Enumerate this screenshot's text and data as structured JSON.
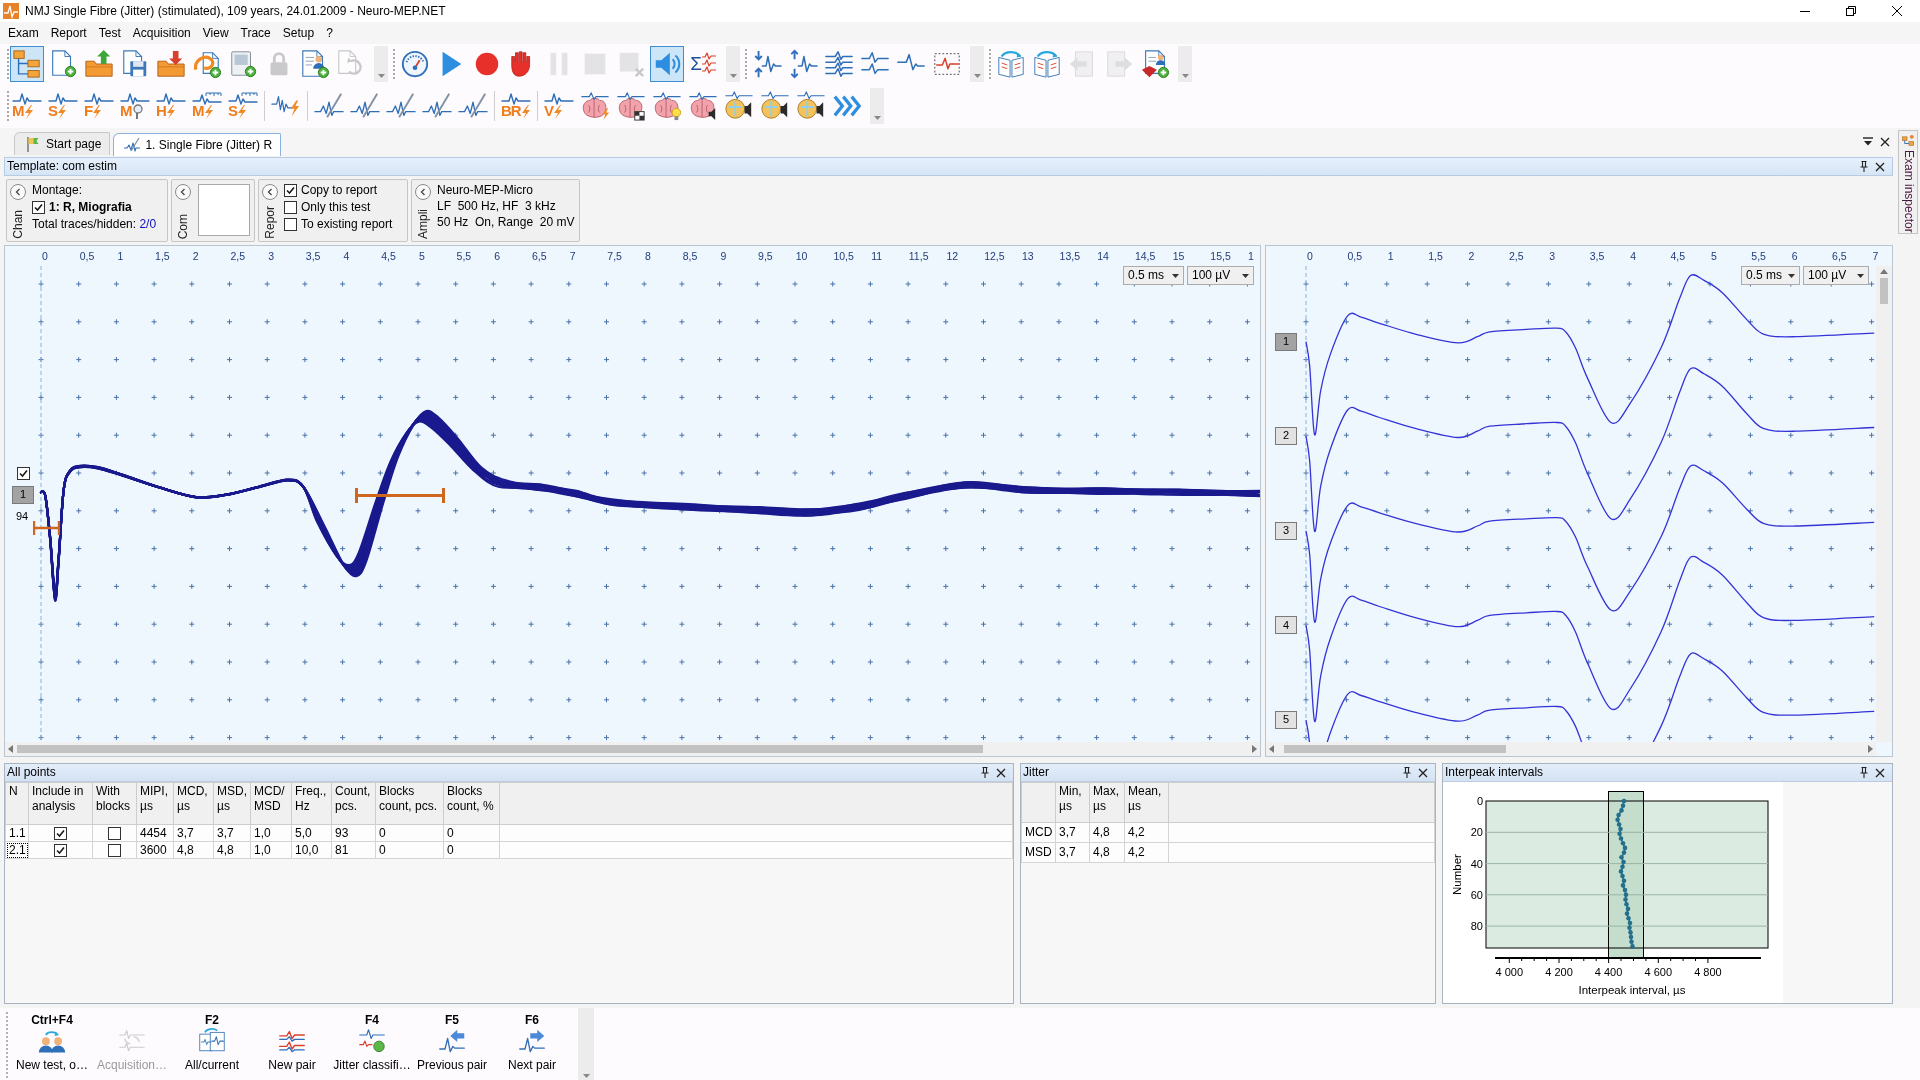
{
  "window": {
    "title": "NMJ Single Fibre (Jitter) (stimulated), 109 years, 24.01.2009 - Neuro-MEP.NET"
  },
  "menu": [
    "Exam",
    "Report",
    "Test",
    "Acquisition",
    "View",
    "Trace",
    "Setup",
    "?"
  ],
  "toolbars": [
    {
      "bands": [
        {
          "groups": [
            [
              {
                "kind": "tree",
                "pressed": true,
                "disabled": false
              },
              {
                "kind": "doc-add",
                "pressed": false,
                "disabled": false
              },
              {
                "kind": "folder-up",
                "pressed": false,
                "disabled": false
              },
              {
                "kind": "save",
                "pressed": false,
                "disabled": false
              },
              {
                "kind": "folder-down",
                "pressed": false,
                "disabled": false
              },
              {
                "kind": "swirl-doc",
                "pressed": false,
                "disabled": false
              },
              {
                "kind": "device-add",
                "pressed": false,
                "disabled": false
              },
              {
                "kind": "lock",
                "pressed": false,
                "disabled": true
              },
              {
                "kind": "report-person",
                "pressed": false,
                "disabled": false
              },
              {
                "kind": "doc-refresh",
                "pressed": false,
                "disabled": true
              }
            ]
          ]
        },
        {
          "groups": [
            [
              {
                "kind": "gauge",
                "pressed": false,
                "disabled": false
              },
              {
                "kind": "play",
                "pressed": false,
                "disabled": false
              },
              {
                "kind": "record",
                "pressed": false,
                "disabled": false
              },
              {
                "kind": "hand",
                "pressed": false,
                "disabled": false
              },
              {
                "kind": "pause",
                "pressed": false,
                "disabled": true
              },
              {
                "kind": "stop",
                "pressed": false,
                "disabled": true
              },
              {
                "kind": "stop-x",
                "pressed": false,
                "disabled": true
              },
              {
                "kind": "speaker",
                "pressed": true,
                "disabled": false
              },
              {
                "kind": "sigma",
                "label": "Σ",
                "pressed": false,
                "disabled": false
              }
            ]
          ]
        },
        {
          "groups": [
            [
              {
                "kind": "arrows-in",
                "pressed": false,
                "disabled": false
              },
              {
                "kind": "arrows-out",
                "pressed": false,
                "disabled": false
              },
              {
                "kind": "wave-stack",
                "pressed": false,
                "disabled": false
              },
              {
                "kind": "wave-split",
                "pressed": false,
                "disabled": false
              },
              {
                "kind": "wave",
                "pressed": false,
                "disabled": false
              },
              {
                "kind": "dashed-box",
                "pressed": false,
                "disabled": false
              }
            ]
          ]
        },
        {
          "groups": [
            [
              {
                "kind": "book-refresh",
                "pressed": false,
                "disabled": false
              },
              {
                "kind": "book-refresh",
                "pressed": false,
                "disabled": false
              },
              {
                "kind": "page-left",
                "pressed": false,
                "disabled": true
              },
              {
                "kind": "page-right",
                "pressed": false,
                "disabled": true
              },
              {
                "kind": "report-add",
                "pressed": false,
                "disabled": false
              }
            ]
          ]
        }
      ]
    },
    {
      "bands": [
        {
          "groups": [
            [
              {
                "kind": "stim",
                "label": "M"
              },
              {
                "kind": "stim",
                "label": "S"
              },
              {
                "kind": "stim",
                "label": "F"
              },
              {
                "kind": "probe",
                "label": "M"
              },
              {
                "kind": "stim",
                "label": "H"
              },
              {
                "kind": "stim-ruler",
                "label": "M"
              },
              {
                "kind": "stim-ruler",
                "label": "S"
              }
            ],
            [
              {
                "kind": "wave-flash"
              }
            ],
            [
              {
                "kind": "needle"
              },
              {
                "kind": "needle"
              },
              {
                "kind": "needle"
              },
              {
                "kind": "needle"
              },
              {
                "kind": "needle"
              }
            ],
            [
              {
                "kind": "stim",
                "label": "BR"
              }
            ],
            [
              {
                "kind": "stim",
                "label": "V"
              },
              {
                "kind": "brain-flash"
              },
              {
                "kind": "brain-grid"
              },
              {
                "kind": "brain-bulb"
              },
              {
                "kind": "brain-speaker"
              },
              {
                "kind": "head-speaker"
              },
              {
                "kind": "head-speaker"
              },
              {
                "kind": "head-speaker"
              },
              {
                "kind": "chevrons"
              }
            ]
          ]
        }
      ]
    }
  ],
  "tabs": [
    {
      "label": "Start page",
      "kind": "flag",
      "selected": false
    },
    {
      "label": "1. Single Fibre (Jitter) R",
      "kind": "needle",
      "selected": true
    }
  ],
  "template_bar": {
    "title": "Template: com estim"
  },
  "settings_panels": [
    {
      "kind": "channels",
      "caption": "Chan",
      "title": "Montage:",
      "channel": {
        "label": "1: R, Miografia",
        "checked": true
      },
      "totals_label": "Total traces/hidden:",
      "totals_value": "2/0"
    },
    {
      "kind": "comment",
      "caption": "Com"
    },
    {
      "kind": "report",
      "caption": "Repor",
      "options": [
        {
          "label": "Copy to report",
          "checked": true
        },
        {
          "label": "Only this test",
          "checked": false
        },
        {
          "label": "To existing report",
          "checked": false
        }
      ]
    },
    {
      "kind": "amplifier",
      "caption": "Ampli",
      "lines": [
        "Neuro-MEP-Micro",
        "LF  500 Hz, HF  3 kHz",
        "50 Hz  On, Range  20 mV"
      ]
    }
  ],
  "trace_views": [
    {
      "kind": "superimposed",
      "axis_labels": [
        "0",
        "0,5",
        "1",
        "1,5",
        "2",
        "2,5",
        "3",
        "3,5",
        "4",
        "4,5",
        "5",
        "5,5",
        "6",
        "6,5",
        "7",
        "7,5",
        "8",
        "8,5",
        "9",
        "9,5",
        "10",
        "10,5",
        "11",
        "11,5",
        "12",
        "12,5",
        "13",
        "13,5",
        "14",
        "14,5",
        "15",
        "15,5",
        "1"
      ],
      "timebase": "0.5 ms",
      "sensitivity": "100 µV",
      "channels": [
        {
          "label": "1",
          "checked": true,
          "selected": true,
          "count": "94"
        }
      ]
    },
    {
      "kind": "stacked",
      "axis_labels": [
        "0",
        "0,5",
        "1",
        "1,5",
        "2",
        "2,5",
        "3",
        "3,5",
        "4",
        "4,5",
        "5",
        "5,5",
        "6",
        "6,5",
        "7"
      ],
      "timebase": "0.5 ms",
      "sensitivity": "100 µV",
      "traces": [
        {
          "label": "1",
          "selected": true
        },
        {
          "label": "2",
          "selected": false
        },
        {
          "label": "3",
          "selected": false
        },
        {
          "label": "4",
          "selected": false
        },
        {
          "label": "5",
          "selected": false
        }
      ]
    }
  ],
  "all_points": {
    "title": "All points",
    "columns": [
      "N",
      "Include in analysis",
      "With blocks",
      "MIPI, µs",
      "MCD, µs",
      "MSD, µs",
      "MCD/MSD",
      "Freq., Hz",
      "Count, pcs.",
      "Blocks count, pcs.",
      "Blocks count, %"
    ],
    "rows": [
      {
        "n": "1.1",
        "include": true,
        "with_blocks": false,
        "focused": false,
        "values": [
          "4454",
          "3,7",
          "3,7",
          "1,0",
          "5,0",
          "93",
          "0",
          "0"
        ]
      },
      {
        "n": "2.1",
        "include": true,
        "with_blocks": false,
        "focused": true,
        "values": [
          "3600",
          "4,8",
          "4,8",
          "1,0",
          "10,0",
          "81",
          "0",
          "0"
        ]
      }
    ]
  },
  "jitter": {
    "title": "Jitter",
    "columns": [
      "Min, µs",
      "Max, µs",
      "Mean, µs"
    ],
    "rows": [
      {
        "label": "MCD",
        "values": [
          "3,7",
          "4,8",
          "4,2"
        ]
      },
      {
        "label": "MSD",
        "values": [
          "3,7",
          "4,8",
          "4,2"
        ]
      }
    ]
  },
  "interpeak": {
    "title": "Interpeak intervals",
    "chart_data": {
      "type": "line",
      "xlabel": "Interpeak interval, µs",
      "ylabel": "Number",
      "x": [
        4462,
        4458,
        4452,
        4440,
        4436,
        4442,
        4448,
        4444,
        4450,
        4458,
        4466,
        4462,
        4452,
        4460,
        4456,
        4450,
        4456,
        4462,
        4458,
        4466,
        4470,
        4468,
        4472,
        4478,
        4474,
        4480,
        4486,
        4484,
        4488,
        4490,
        4492,
        4496
      ],
      "series": [
        {
          "color": "#23708c",
          "values": [
            0,
            3,
            6,
            9,
            12,
            15,
            18,
            21,
            24,
            27,
            30,
            33,
            36,
            39,
            42,
            45,
            48,
            51,
            54,
            57,
            60,
            63,
            66,
            69,
            72,
            75,
            78,
            81,
            84,
            87,
            90,
            93
          ]
        }
      ],
      "xlim": [
        3906,
        5042
      ],
      "ylim": [
        94,
        0
      ],
      "xticks": [
        {
          "value": 4000,
          "label": "4 000"
        },
        {
          "value": 4200,
          "label": "4 200"
        },
        {
          "value": 4400,
          "label": "4 400"
        },
        {
          "value": 4600,
          "label": "4 600"
        },
        {
          "value": 4800,
          "label": "4 800"
        }
      ],
      "yticks": [
        0,
        20,
        40,
        60,
        80
      ],
      "grid": true
    }
  },
  "bottom_toolbar": [
    {
      "shortcut": "Ctrl+F4",
      "label": "New test, o…",
      "kind": "users",
      "disabled": false
    },
    {
      "label": "Acquisition…",
      "kind": "sync-wave",
      "disabled": true
    },
    {
      "shortcut": "F2",
      "label": "All/current",
      "kind": "windows",
      "disabled": false
    },
    {
      "label": "New pair",
      "kind": "pair-waves",
      "disabled": false
    },
    {
      "shortcut": "F4",
      "label": "Jitter classifi…",
      "kind": "jitter",
      "disabled": false
    },
    {
      "shortcut": "F5",
      "label": "Previous pair",
      "kind": "prev",
      "disabled": false
    },
    {
      "shortcut": "F6",
      "label": "Next pair",
      "kind": "next",
      "disabled": false
    }
  ],
  "side_panel": {
    "label": "Exam inspector"
  }
}
